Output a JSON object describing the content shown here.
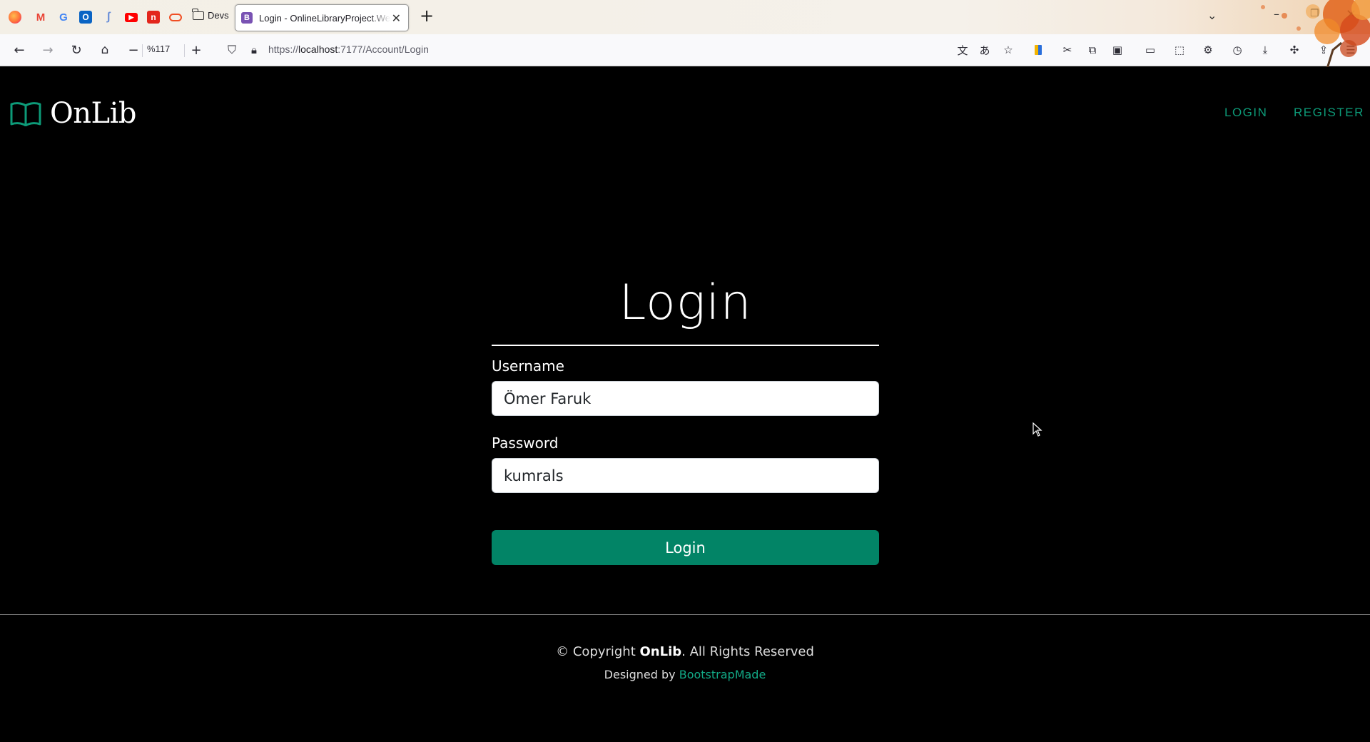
{
  "browser": {
    "bookmarks": [
      {
        "name": "firefox",
        "glyph": "",
        "color": "#ff7139"
      },
      {
        "name": "gmail",
        "glyph": "M",
        "color": "#ea4335"
      },
      {
        "name": "google",
        "glyph": "G",
        "color": "#4285f4"
      },
      {
        "name": "outlook",
        "glyph": "O",
        "color": "#0a64c4"
      },
      {
        "name": "feather",
        "glyph": "",
        "color": "#6a8fd8"
      },
      {
        "name": "youtube",
        "glyph": "▶",
        "color": "#ff0000"
      },
      {
        "name": "red-app",
        "glyph": "n",
        "color": "#e3261c"
      },
      {
        "name": "oracle",
        "glyph": "",
        "color": "#f04e23"
      }
    ],
    "bookmark_folder": "Devs",
    "tab": {
      "favicon": "B",
      "title": "Login - OnlineLibraryProject.We"
    },
    "zoom": "%117",
    "url_prefix": "https://",
    "url_host": "localhost",
    "url_rest": ":7177/Account/Login"
  },
  "site": {
    "brand": "OnLib",
    "nav": {
      "login": "LOGIN",
      "register": "REGISTER"
    },
    "accent_color": "#0d9a78"
  },
  "form": {
    "title": "Login",
    "username_label": "Username",
    "username_value": "Ömer Faruk",
    "password_label": "Password",
    "password_value": "kumrals",
    "submit_label": "Login"
  },
  "footer": {
    "copyright_prefix": "© Copyright ",
    "copyright_brand": "OnLib",
    "copyright_suffix": ". All Rights Reserved",
    "designed_by": "Designed by ",
    "designer": "BootstrapMade"
  }
}
